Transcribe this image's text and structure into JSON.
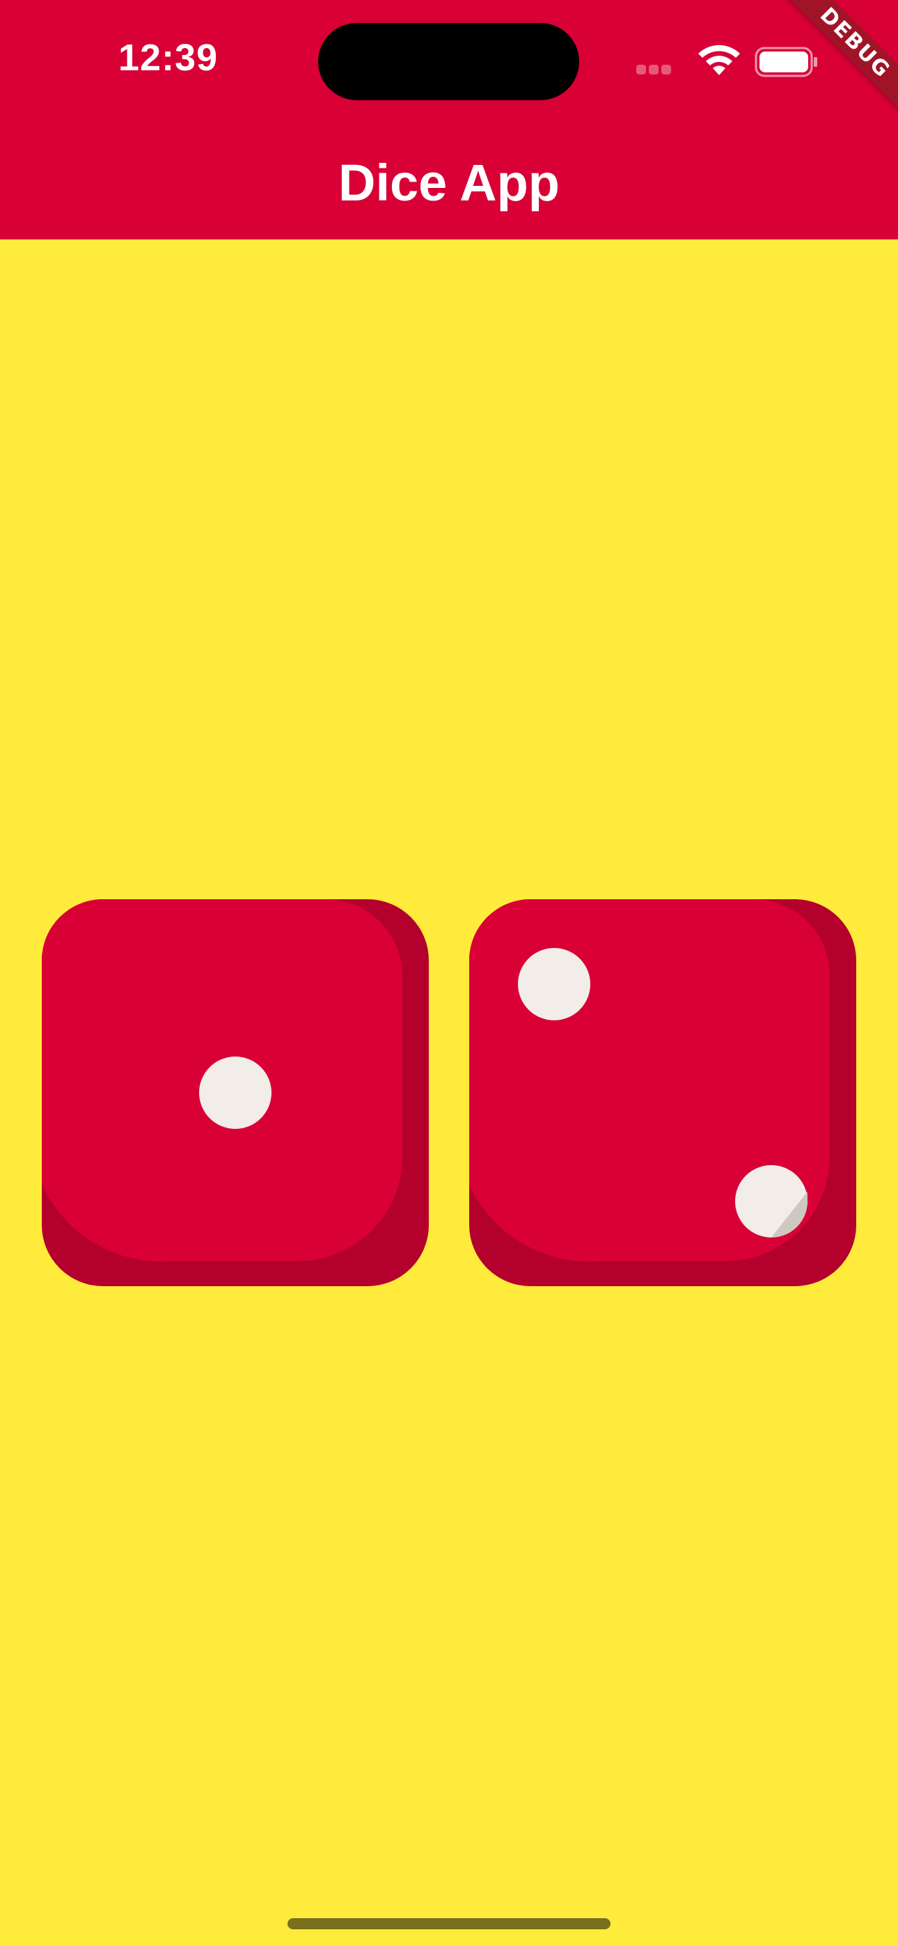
{
  "status_bar": {
    "time": "12:39",
    "icons": [
      "signal-icon",
      "wifi-icon",
      "battery-icon"
    ]
  },
  "debug_banner": "DEBUG",
  "app_bar": {
    "title": "Dice App"
  },
  "dice": [
    {
      "name": "left-die",
      "value": 1,
      "icon": "dice-one-icon"
    },
    {
      "name": "right-die",
      "value": 2,
      "icon": "dice-two-icon"
    }
  ],
  "colors": {
    "app_bar": "#D90036",
    "background": "#FFEB3B",
    "die_face": "#D90036",
    "die_shadow": "#B3002D",
    "pip": "#F2EDE8"
  }
}
